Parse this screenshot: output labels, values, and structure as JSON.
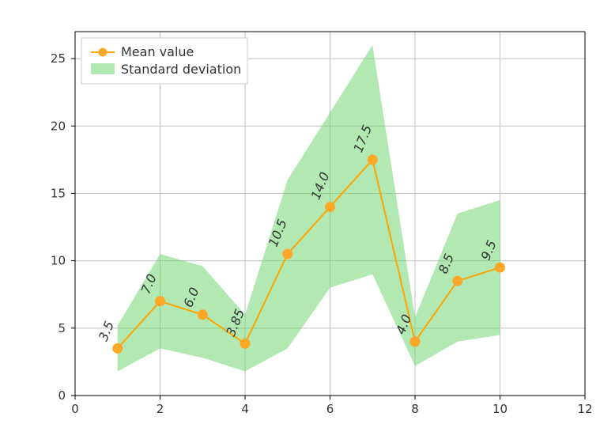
{
  "chart_data": {
    "type": "line",
    "x": [
      1,
      2,
      3,
      4,
      5,
      6,
      7,
      8,
      9,
      10
    ],
    "series": [
      {
        "name": "Mean value",
        "values": [
          3.5,
          7.0,
          6.0,
          3.85,
          10.5,
          14.0,
          17.5,
          4.0,
          8.5,
          9.5
        ],
        "labels": [
          "3.5",
          "7.0",
          "6.0",
          "3.85",
          "10.5",
          "14.0",
          "17.5",
          "4.0",
          "8.5",
          "9.5"
        ]
      }
    ],
    "band": {
      "name": "Standard deviation",
      "lower": [
        1.8,
        3.5,
        2.8,
        1.8,
        3.5,
        8.0,
        9.0,
        2.2,
        4.0,
        4.5
      ],
      "upper": [
        5.2,
        10.5,
        9.6,
        6.0,
        16.0,
        21.0,
        26.0,
        5.8,
        13.5,
        14.5
      ]
    },
    "xlabel": "",
    "ylabel": "",
    "xlim": [
      0,
      12
    ],
    "ylim": [
      0,
      27
    ],
    "xticks": [
      0,
      2,
      4,
      6,
      8,
      10,
      12
    ],
    "yticks": [
      0,
      5,
      10,
      15,
      20,
      25
    ],
    "legend": [
      "Mean value",
      "Standard deviation"
    ],
    "legend_position": "upper left",
    "grid": true,
    "colors": {
      "mean": "#ffa726",
      "band": "#72d572"
    }
  }
}
